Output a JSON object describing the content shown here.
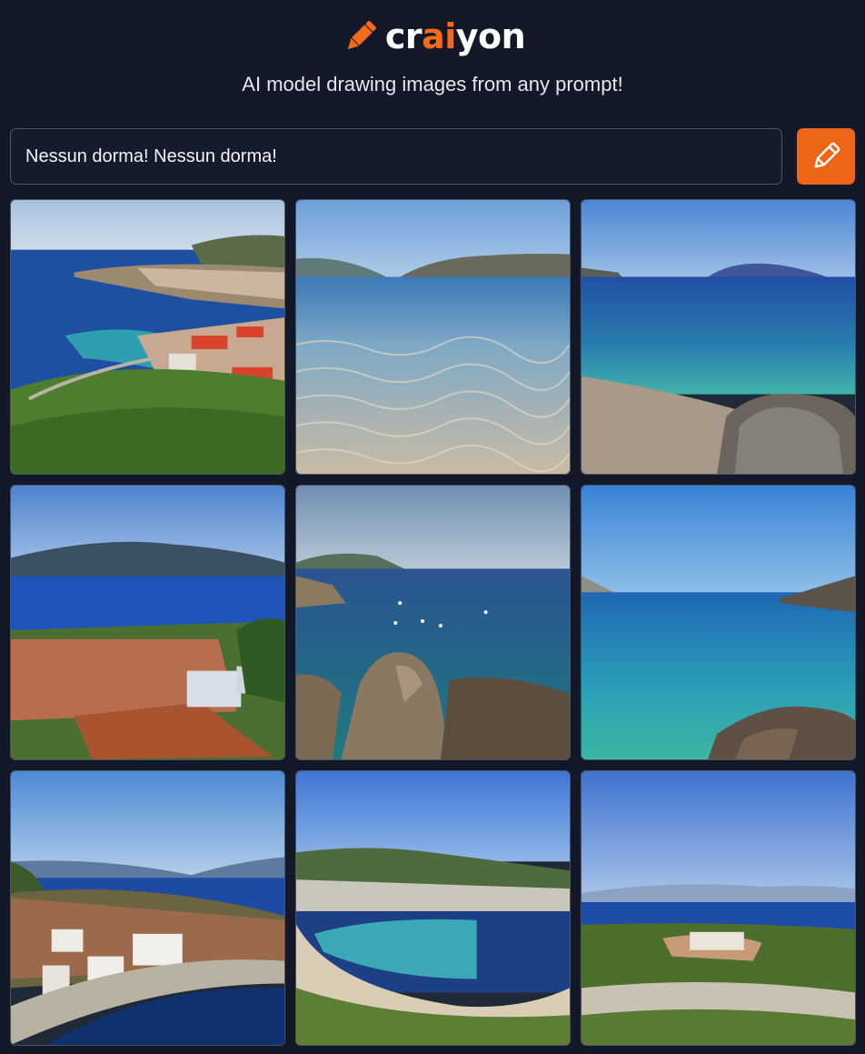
{
  "header": {
    "logo_prefix": "cr",
    "logo_highlight": "ai",
    "logo_suffix": "yon",
    "logo_icon": "pencil-icon",
    "tagline": "AI model drawing images from any prompt!"
  },
  "prompt": {
    "value": "Nessun dorma! Nessun dorma!",
    "button_icon": "pencil-icon"
  },
  "colors": {
    "accent": "#ee6518",
    "background": "#121827"
  },
  "gallery": {
    "images": [
      {
        "subject": "coastal village on a hillside with red roofs above a bay"
      },
      {
        "subject": "clear shallow water over sandy seabed with rocky island"
      },
      {
        "subject": "pebble beach with turquoise sea and distant island"
      },
      {
        "subject": "red-roofed village above a blue bay with mountains"
      },
      {
        "subject": "rocky cove with boats on calm blue water"
      },
      {
        "subject": "clear turquoise sea with rocky shoreline"
      },
      {
        "subject": "hillside village with white houses by the sea"
      },
      {
        "subject": "curved beach bay below a white-washed town"
      },
      {
        "subject": "green coastal hills with village and distant mountains"
      }
    ]
  }
}
